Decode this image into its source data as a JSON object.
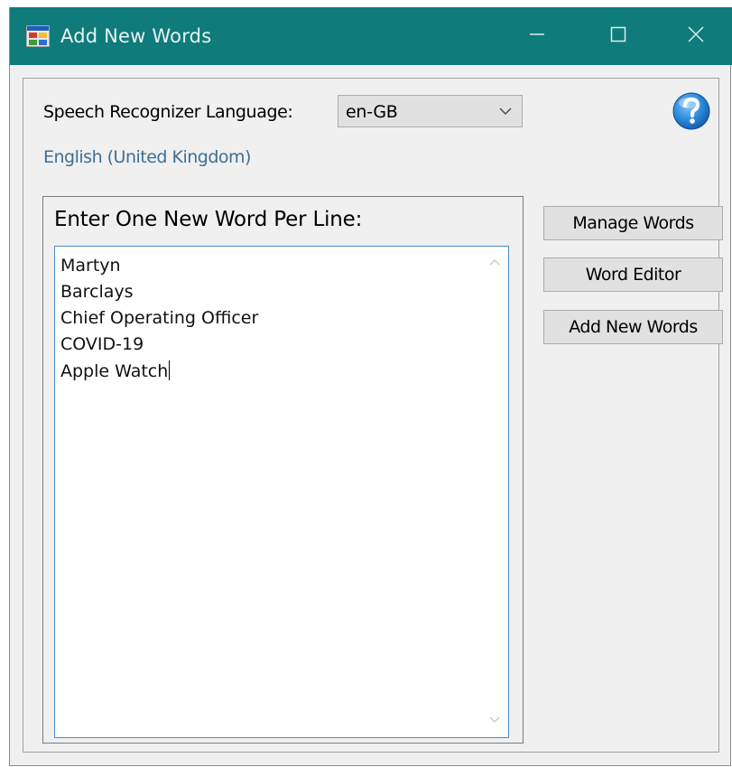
{
  "window": {
    "title": "Add New Words",
    "icon": "app-window-icon",
    "controls": [
      "minimize-icon",
      "maximize-icon",
      "close-icon"
    ]
  },
  "language": {
    "label": "Speech Recognizer Language:",
    "selected": "en-GB",
    "display_name": "English (United Kingdom)"
  },
  "help": {
    "icon": "help-question-icon"
  },
  "words_group": {
    "title": "Enter One New Word Per Line:",
    "lines": [
      "Martyn",
      "Barclays",
      "Chief Operating Officer",
      "COVID-19",
      "Apple Watch"
    ]
  },
  "buttons": {
    "manage_words": "Manage Words",
    "word_editor": "Word Editor",
    "add_new_words": "Add New Words"
  },
  "colors": {
    "titlebar": "#0f7b7b",
    "language_name": "#3d6f96",
    "textarea_border": "#4a8cc8"
  }
}
